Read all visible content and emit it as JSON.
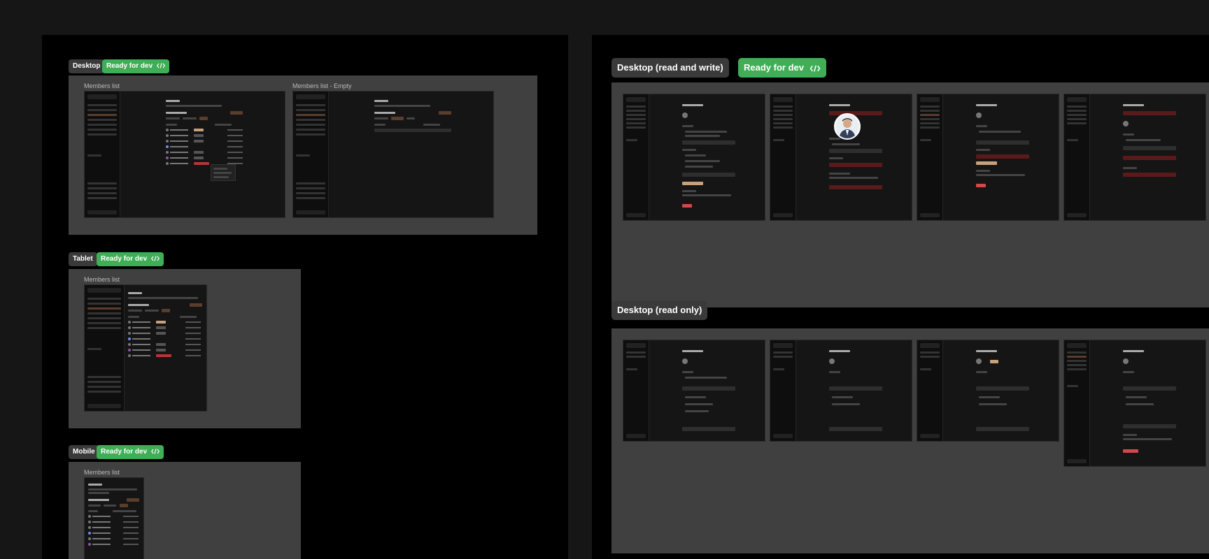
{
  "left_panel": {
    "sections": [
      {
        "tag": "Desktop",
        "status": "Ready for dev",
        "frames": [
          {
            "title": "Members list"
          },
          {
            "title": "Members list - Empty"
          }
        ]
      },
      {
        "tag": "Tablet",
        "status": "Ready for dev",
        "frames": [
          {
            "title": "Members list"
          }
        ]
      },
      {
        "tag": "Mobile",
        "status": "Ready for dev",
        "frames": [
          {
            "title": "Members list"
          }
        ]
      }
    ]
  },
  "right_panel": {
    "sections": [
      {
        "tag": "Desktop (read and write)",
        "status": "Ready for dev"
      },
      {
        "tag": "Desktop (read only)"
      }
    ]
  },
  "colors": {
    "canvas": "#161616",
    "panel": "#000000",
    "section_box": "#404040",
    "ready_badge": "#3fae56",
    "tag_badge": "#3a3a3a"
  },
  "icons": {
    "code": "code-brackets-icon",
    "avatar": "profile-photo-avatar"
  }
}
